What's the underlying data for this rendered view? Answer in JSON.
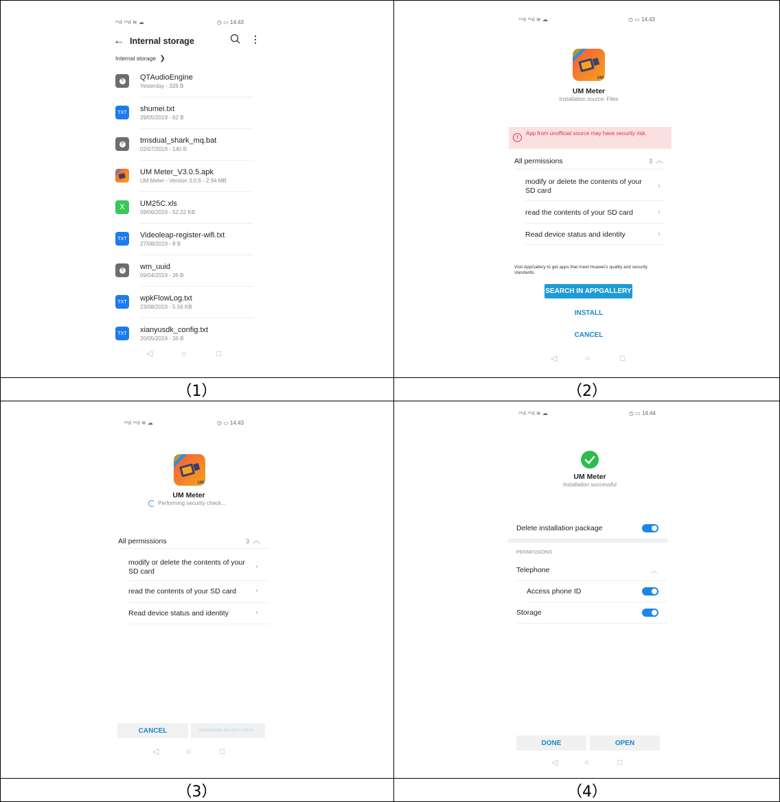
{
  "captions": [
    "（1）",
    "（2）",
    "（3）",
    "（4）"
  ],
  "status_bar": {
    "signal": "⁴⁶ıl ⁴⁶ıl ≋ ☁",
    "right_1": "◷ ▭ 14:43",
    "right_4": "◷ ▭ 14:44"
  },
  "panel1": {
    "title": "Internal storage",
    "breadcrumb": "Internal storage",
    "files": [
      {
        "name": "QTAudioEngine",
        "meta": "Yesterday - 328 B",
        "icon": "question-icon",
        "kind": "gray"
      },
      {
        "name": "shumei.txt",
        "meta": "29/05/2019 - 62 B",
        "icon": "txt-file-icon",
        "kind": "blue"
      },
      {
        "name": "tmsdual_shark_mq.bat",
        "meta": "02/07/2019 - 140 B",
        "icon": "question-icon",
        "kind": "gray"
      },
      {
        "name": "UM Meter_V3.0.5.apk",
        "meta": "UM Meter - Version 3.0.5 - 2.94 MB",
        "icon": "app-icon",
        "kind": "apk"
      },
      {
        "name": "UM25C.xls",
        "meta": "09/06/2019 - 52.22 KB",
        "icon": "excel-file-icon",
        "kind": "green"
      },
      {
        "name": "Videoleap-register-wifi.txt",
        "meta": "27/08/2019 - 8 B",
        "icon": "txt-file-icon",
        "kind": "blue"
      },
      {
        "name": "wm_uuid",
        "meta": "09/04/2019 - 36 B",
        "icon": "question-icon",
        "kind": "gray"
      },
      {
        "name": "wpkFlowLog.txt",
        "meta": "23/08/2019 - 5.56 KB",
        "icon": "txt-file-icon",
        "kind": "blue"
      },
      {
        "name": "xianyusdk_config.txt",
        "meta": "20/05/2019 - 36 B",
        "icon": "txt-file-icon",
        "kind": "blue"
      }
    ],
    "txt_label": "TXT",
    "xls_label": "X",
    "unknown_label": "?"
  },
  "app": {
    "name": "UM Meter",
    "source": "Installation source: Files",
    "warning": "App from unofficial source may have security risk.",
    "all_permissions": "All permissions",
    "perm_count": "3",
    "permissions": [
      "modify or delete the contents of your SD card",
      "read the contents of your SD card",
      "Read device status and identity"
    ],
    "gallery_note": "Visit AppGallery to get apps that meet Huawei's quality and security standards.",
    "search_btn": "SEARCH IN APPGALLERY",
    "install_btn": "INSTALL",
    "cancel_btn": "CANCEL",
    "checking": "Performing security check...",
    "checking_btn": "PERFORMING SECURITY CHECK...",
    "success": "Installation successful",
    "delete_pkg": "Delete installation package",
    "permissions_header": "PERMISSIONS",
    "telephone": "Telephone",
    "access_phone_id": "Access phone ID",
    "storage": "Storage",
    "done_btn": "DONE",
    "open_btn": "OPEN",
    "icon_badge": "UM"
  },
  "nav_bar": {
    "back": "◁",
    "home": "○",
    "recent": "□"
  },
  "colors": {
    "accent": "#1d86c9",
    "warning_bg": "#fbe0e2",
    "warning_text": "#d9363e",
    "toggle": "#1a88e6",
    "success": "#2dbd4e"
  }
}
